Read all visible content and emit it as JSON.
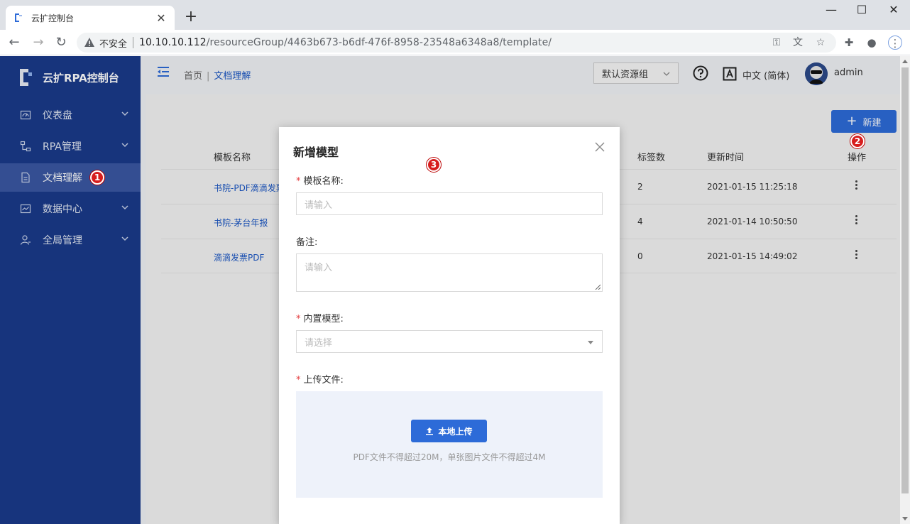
{
  "browser": {
    "tab_title": "云扩控制台",
    "insecure_label": "不安全",
    "url_host": "10.10.10.112",
    "url_path": "/resourceGroup/4463b673-b6df-476f-8958-23548a6348a8/template/"
  },
  "sidebar": {
    "logo_text": "云扩RPA控制台",
    "items": [
      {
        "label": "仪表盘"
      },
      {
        "label": "RPA管理"
      },
      {
        "label": "文档理解"
      },
      {
        "label": "数据中心"
      },
      {
        "label": "全局管理"
      }
    ]
  },
  "header": {
    "breadcrumb_home": "首页",
    "breadcrumb_sep": "|",
    "breadcrumb_current": "文档理解",
    "resource_group": "默认资源组",
    "language": "中文 (简体)",
    "username": "admin"
  },
  "content": {
    "new_button": "新建",
    "columns": {
      "name": "模板名称",
      "tags": "标签数",
      "updated": "更新时间",
      "actions": "操作"
    },
    "rows": [
      {
        "name": "书院-PDF滴滴发票",
        "tags": "2",
        "updated": "2021-01-15 11:25:18"
      },
      {
        "name": "书院-茅台年报",
        "tags": "4",
        "updated": "2021-01-14 10:50:50"
      },
      {
        "name": "滴滴发票PDF",
        "tags": "0",
        "updated": "2021-01-15 14:49:02"
      }
    ]
  },
  "badges": {
    "one": "1",
    "two": "2",
    "three": "3"
  },
  "modal": {
    "title": "新增模型",
    "required_mark": "*",
    "name_label": "模板名称:",
    "name_placeholder": "请输入",
    "note_label": "备注:",
    "note_placeholder": "请输入",
    "model_label": "内置模型:",
    "model_placeholder": "请选择",
    "upload_label": "上传文件:",
    "upload_button": "本地上传",
    "upload_hint": "PDF文件不得超过20M，单张图片文件不得超过4M"
  },
  "colors": {
    "sidebar_bg": "#1a3a8b",
    "primary": "#2d6bd8",
    "badge": "#d71d1d"
  }
}
